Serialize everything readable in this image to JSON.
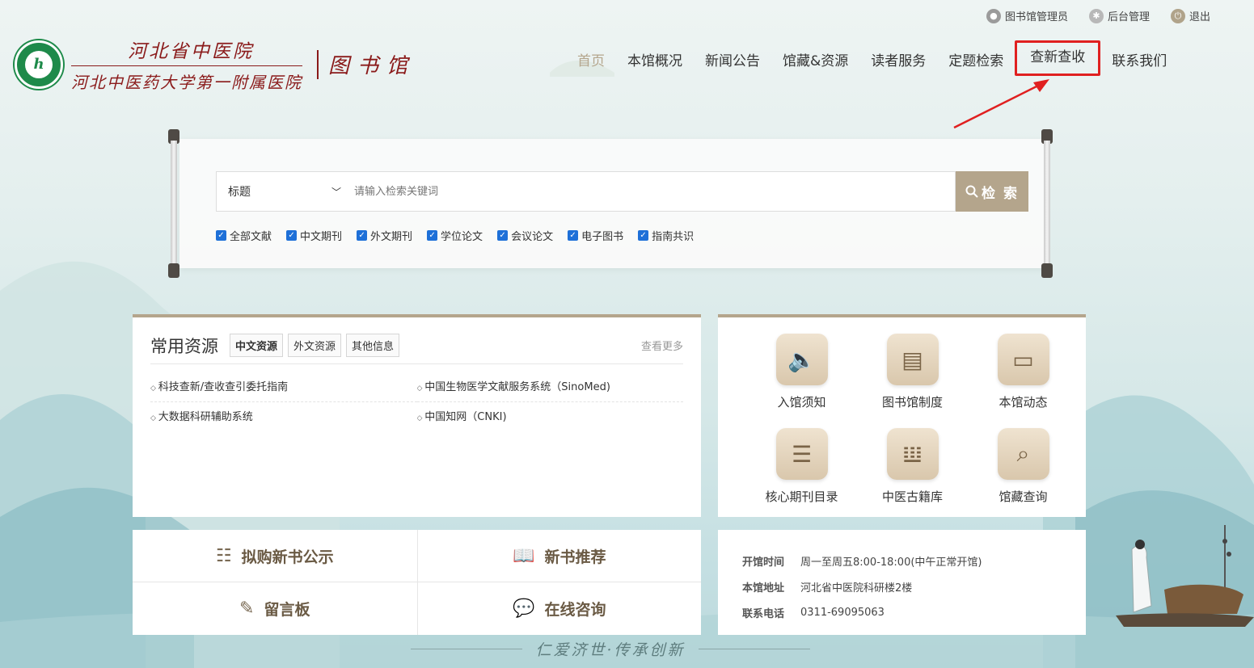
{
  "topbar": {
    "admin_label": "图书馆管理员",
    "backend_label": "后台管理",
    "logout_label": "退出"
  },
  "logo": {
    "line1": "河北省中医院",
    "line2": "河北中医药大学第一附属医院",
    "library": "图书馆"
  },
  "nav": {
    "items": [
      "首页",
      "本馆概况",
      "新闻公告",
      "馆藏&资源",
      "读者服务",
      "定题检索",
      "查新查收",
      "联系我们"
    ]
  },
  "search": {
    "field_value": "标题",
    "placeholder": "请输入检索关键词",
    "button_label": "检 索",
    "checkboxes": [
      "全部文献",
      "中文期刊",
      "外文期刊",
      "学位论文",
      "会议论文",
      "电子图书",
      "指南共识"
    ]
  },
  "resources": {
    "title": "常用资源",
    "tabs": [
      "中文资源",
      "外文资源",
      "其他信息"
    ],
    "more": "查看更多",
    "items": [
      "科技查新/查收查引委托指南",
      "中国生物医学文献服务系统（SinoMed)",
      "大数据科研辅助系统",
      "中国知网（CNKI)"
    ]
  },
  "services": [
    {
      "label": "入馆须知",
      "icon": "speaker-icon"
    },
    {
      "label": "图书馆制度",
      "icon": "document-badge-icon"
    },
    {
      "label": "本馆动态",
      "icon": "message-icon"
    },
    {
      "label": "核心期刊目录",
      "icon": "list-book-icon"
    },
    {
      "label": "中医古籍库",
      "icon": "bamboo-scroll-icon"
    },
    {
      "label": "馆藏查询",
      "icon": "search-document-icon"
    }
  ],
  "quick": {
    "purchase": "拟购新书公示",
    "new_books": "新书推荐",
    "message_board": "留言板",
    "consult": "在线咨询"
  },
  "info": {
    "open_key": "开馆时间",
    "open_val": "周一至周五8:00-18:00(中午正常开馆)",
    "addr_key": "本馆地址",
    "addr_val": "河北省中医院科研楼2楼",
    "phone_key": "联系电话",
    "phone_val": "0311-69095063"
  },
  "slogan": "仁爱济世·传承创新",
  "colors": {
    "accent": "#b4a58c",
    "brand_red": "#8a1a1a",
    "highlight_red": "#e02020",
    "checkbox_blue": "#1e70d8"
  }
}
